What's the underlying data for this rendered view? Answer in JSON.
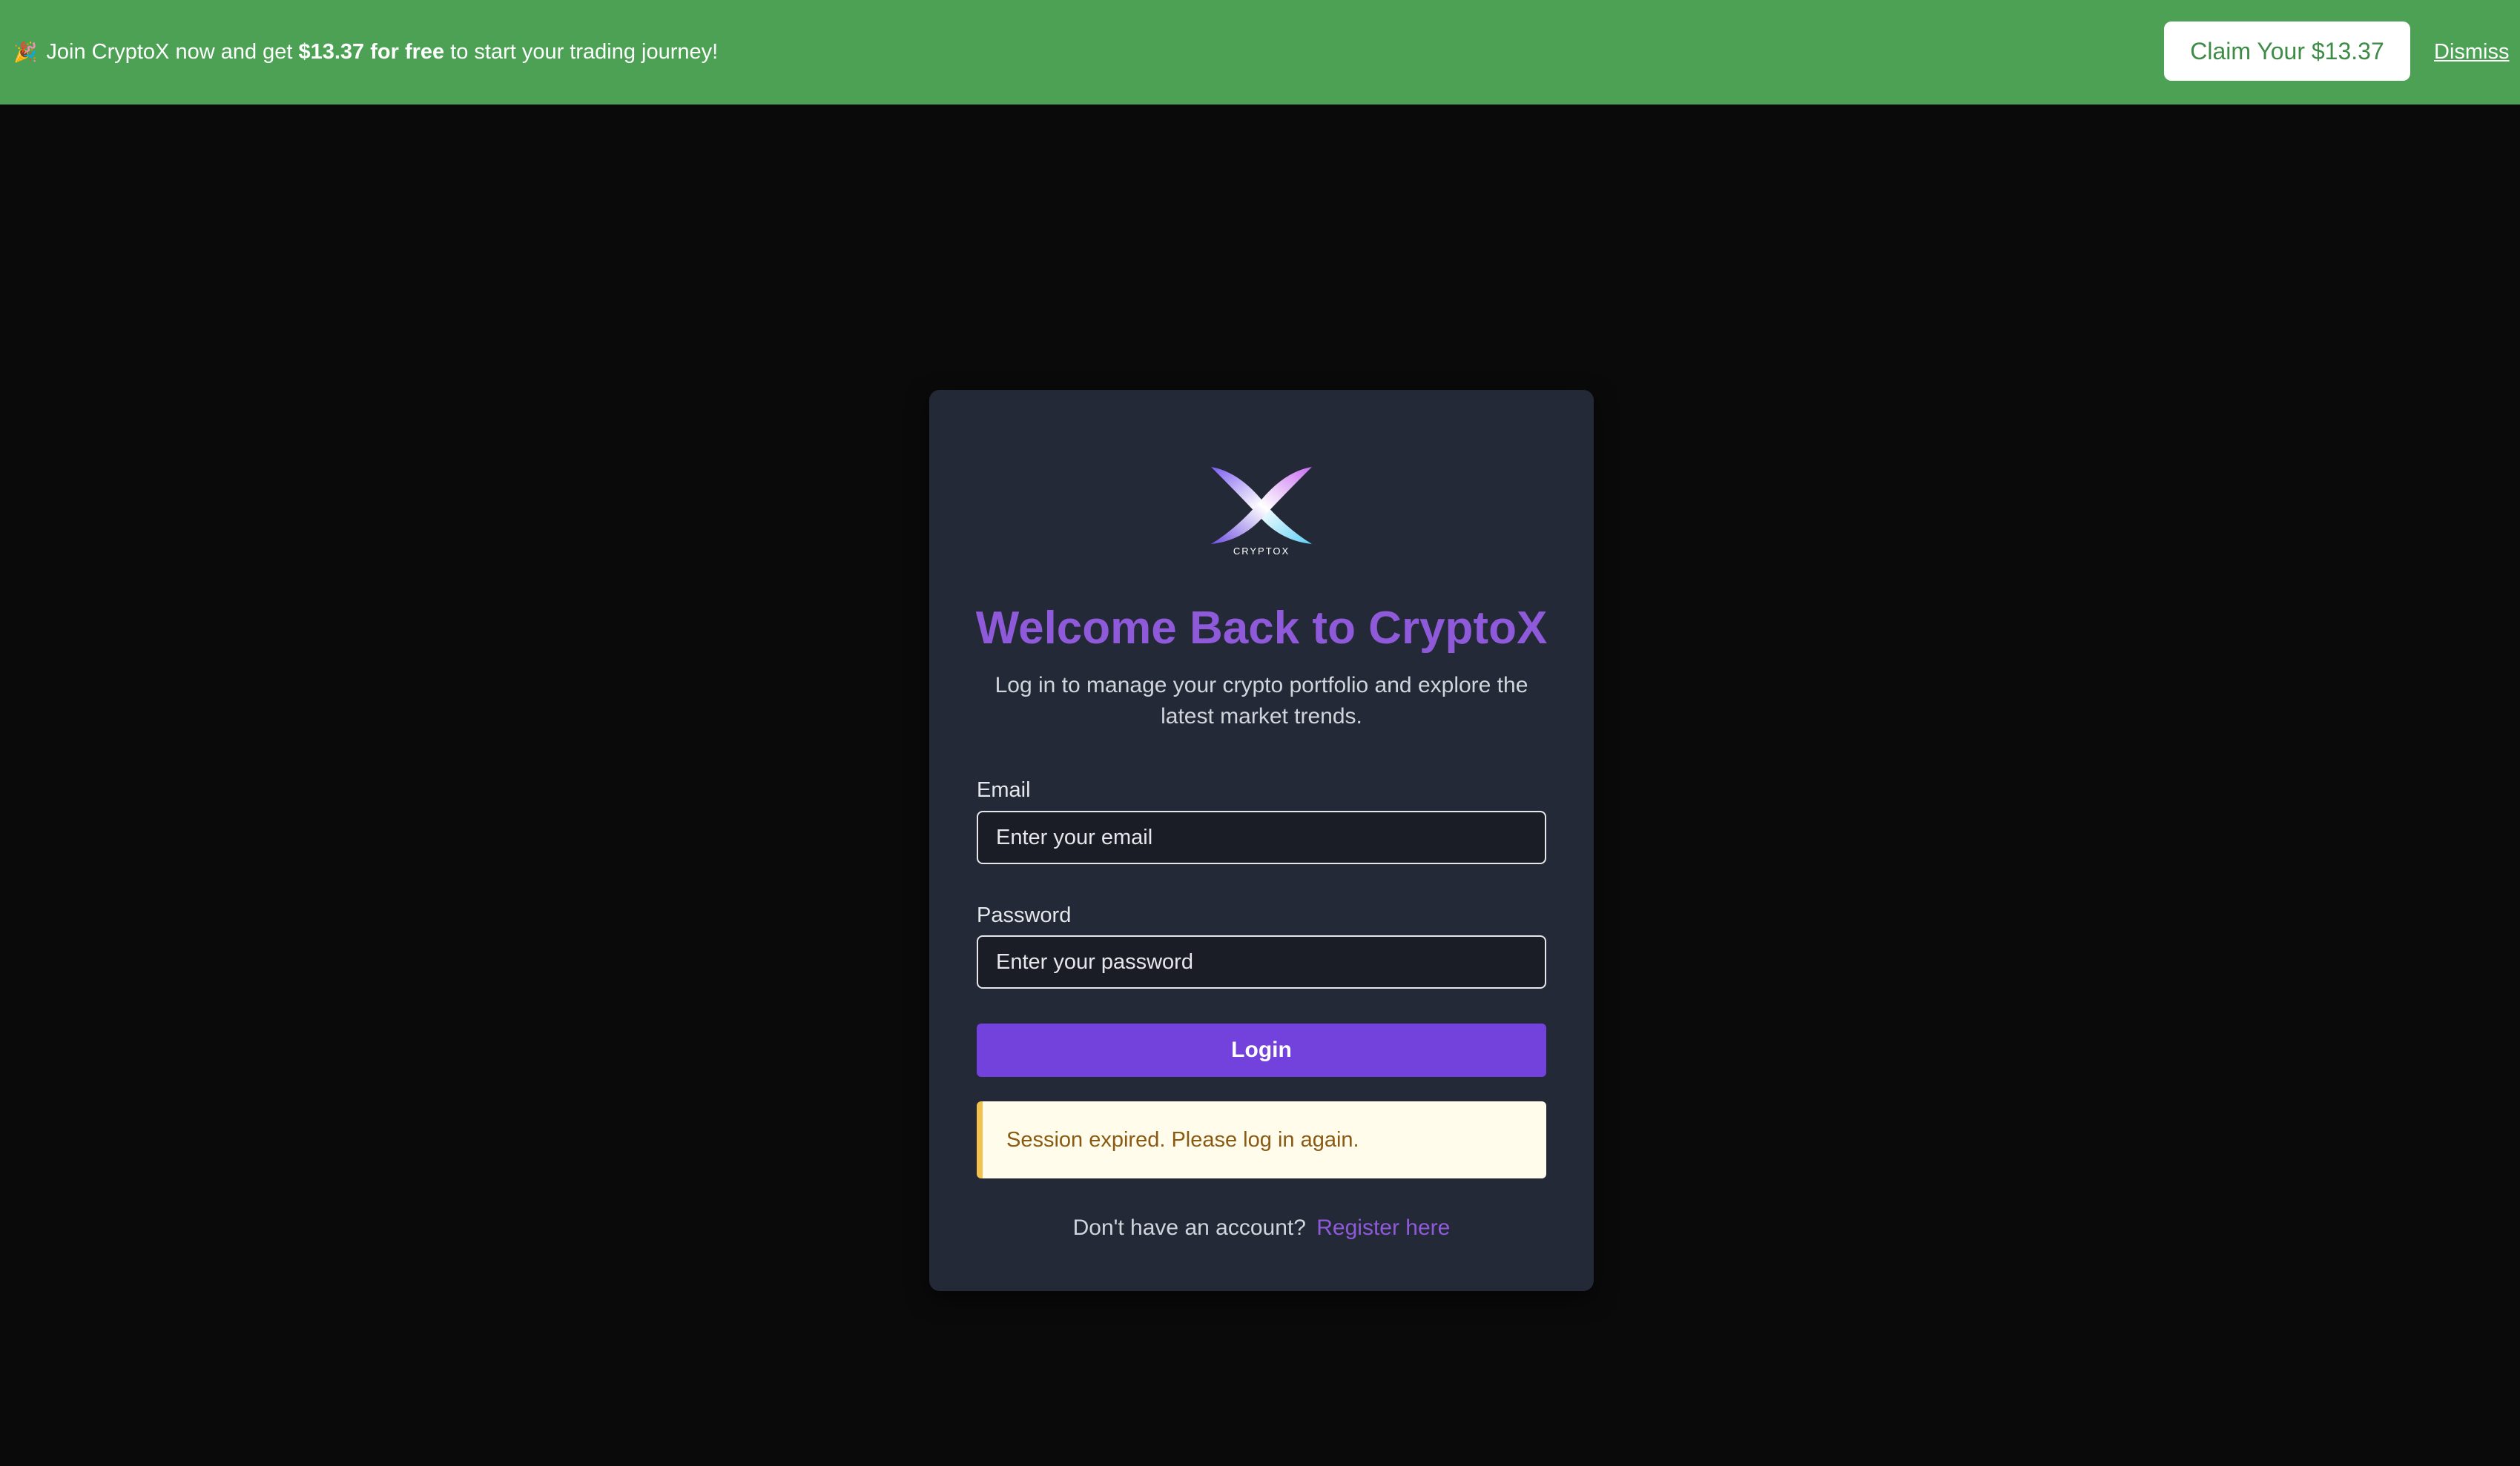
{
  "banner": {
    "emoji": "🎉",
    "text_before": "Join CryptoX now and get",
    "text_bold": "$13.37 for free",
    "text_after": "to start your trading journey!",
    "claim_label": "Claim Your $13.37",
    "dismiss_label": "Dismiss",
    "background_color": "#4ca154"
  },
  "logo": {
    "icon": "cryptox-x-logo",
    "wordmark": "CRYPTOX"
  },
  "card": {
    "title": "Welcome Back to CryptoX",
    "subtitle": "Log in to manage your crypto portfolio and explore the latest market trends.",
    "accent_color": "#8f5ad9"
  },
  "form": {
    "email_label": "Email",
    "email_placeholder": "Enter your email",
    "email_value": "",
    "password_label": "Password",
    "password_placeholder": "Enter your password",
    "password_value": "",
    "login_label": "Login",
    "login_color": "#7341db"
  },
  "alert": {
    "message": "Session expired. Please log in again.",
    "type": "warning"
  },
  "register": {
    "prompt": "Don't have an account?",
    "link_label": "Register here"
  }
}
